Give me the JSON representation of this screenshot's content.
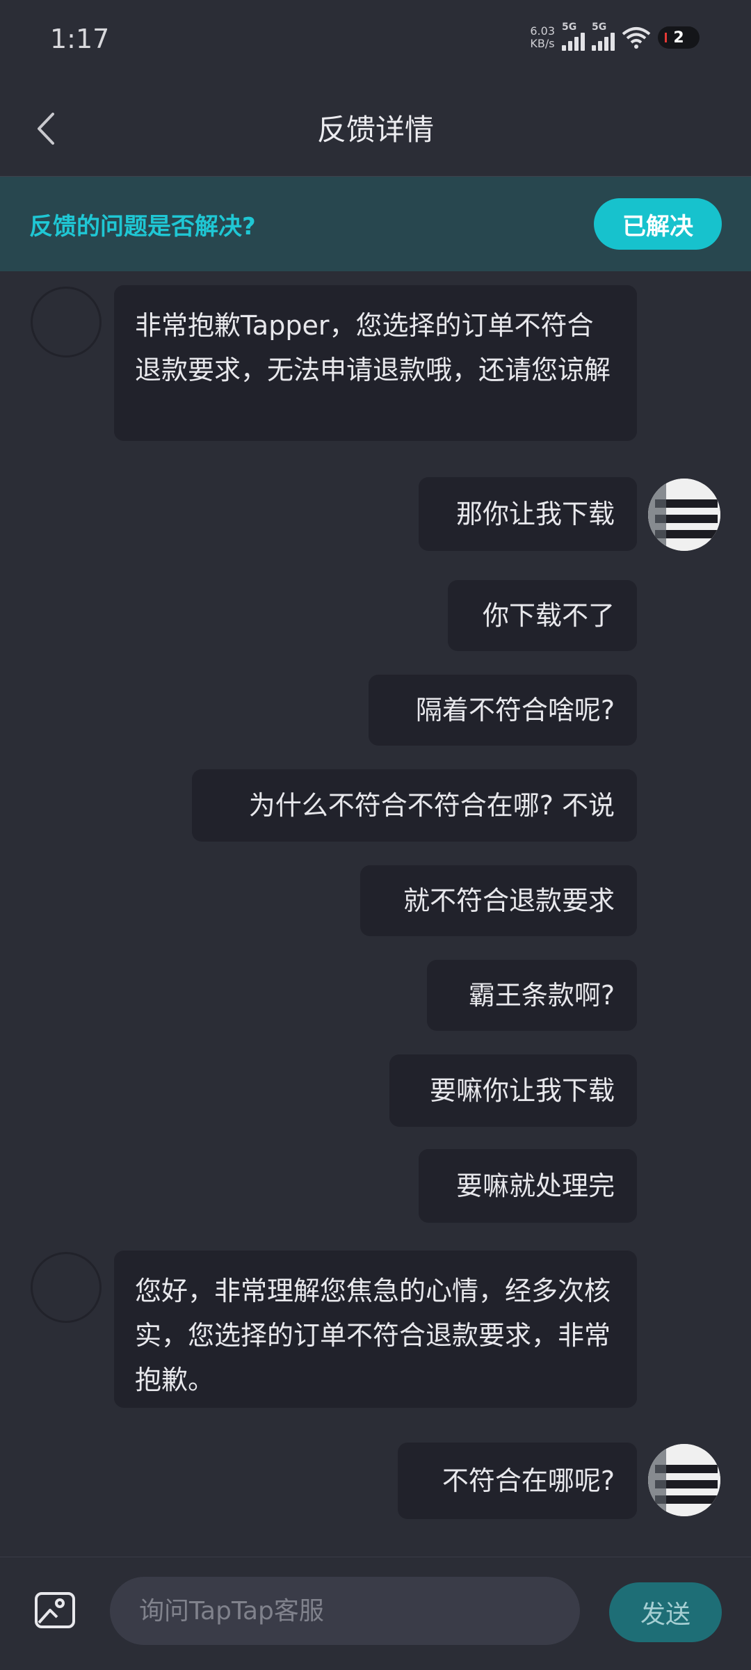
{
  "status_bar": {
    "time": "1:17",
    "net_speed_value": "6.03",
    "net_speed_unit": "KB/s",
    "signal1_label": "5G",
    "signal2_label": "5G",
    "battery": "2"
  },
  "header": {
    "title": "反馈详情"
  },
  "feedback": {
    "question": "反馈的问题是否解决?",
    "resolved_label": "已解决"
  },
  "messages": [
    {
      "side": "left",
      "text": "非常抱歉Tapper，您选择的订单不符合退款要求，无法申请退款哦，还请您谅解"
    },
    {
      "side": "right",
      "text": "那你让我下载",
      "avatar": true
    },
    {
      "side": "right",
      "text": "你下载不了"
    },
    {
      "side": "right",
      "text": "隔着不符合啥呢?"
    },
    {
      "side": "right",
      "text": "为什么不符合不符合在哪? 不说"
    },
    {
      "side": "right",
      "text": "就不符合退款要求"
    },
    {
      "side": "right",
      "text": "霸王条款啊?"
    },
    {
      "side": "right",
      "text": "要嘛你让我下载"
    },
    {
      "side": "right",
      "text": "要嘛就处理完"
    },
    {
      "side": "left",
      "text": "您好，非常理解您焦急的心情，经多次核实，您选择的订单不符合退款要求，非常抱歉。"
    },
    {
      "side": "right",
      "text": "不符合在哪呢?",
      "avatar": true
    }
  ],
  "input": {
    "placeholder": "询问TapTap客服",
    "send_label": "发送"
  },
  "icons": {
    "back": "chevron-left-icon",
    "image": "image-icon",
    "wifi": "wifi-icon"
  },
  "colors": {
    "accent": "#17c2cd",
    "background": "#2b2d36",
    "bubble": "#21222b",
    "banner": "#28474f"
  }
}
